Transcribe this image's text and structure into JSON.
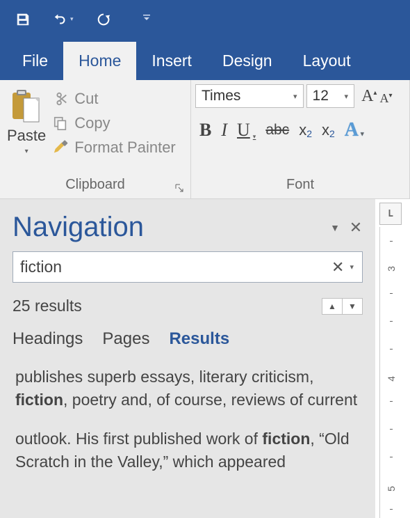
{
  "titlebar": {
    "save_tooltip": "Save",
    "undo_tooltip": "Undo",
    "redo_tooltip": "Redo"
  },
  "ribbon": {
    "tabs": {
      "file": "File",
      "home": "Home",
      "insert": "Insert",
      "design": "Design",
      "layout": "Layout"
    },
    "clipboard": {
      "label": "Clipboard",
      "paste": "Paste",
      "cut": "Cut",
      "copy": "Copy",
      "format_painter": "Format Painter"
    },
    "font": {
      "label": "Font",
      "name": "Times",
      "size": "12",
      "bold": "B",
      "italic": "I",
      "underline": "U",
      "strike": "abc",
      "subscript": "x",
      "superscript": "x",
      "text_effect": "A"
    }
  },
  "navigation": {
    "title": "Navigation",
    "search_value": "fiction",
    "results_count": "25 results",
    "tabs": {
      "headings": "Headings",
      "pages": "Pages",
      "results": "Results"
    },
    "results": [
      {
        "pre": "publishes superb essays, literary criticism, ",
        "match": "fiction",
        "post": ", poetry and, of course, reviews of current"
      },
      {
        "pre": "outlook.  His first published work of ",
        "match": "fiction",
        "post": ", “Old Scratch in the Valley,” which appeared"
      }
    ]
  },
  "ruler": {
    "corner": "L",
    "marks": [
      "3",
      "4",
      "5"
    ]
  }
}
